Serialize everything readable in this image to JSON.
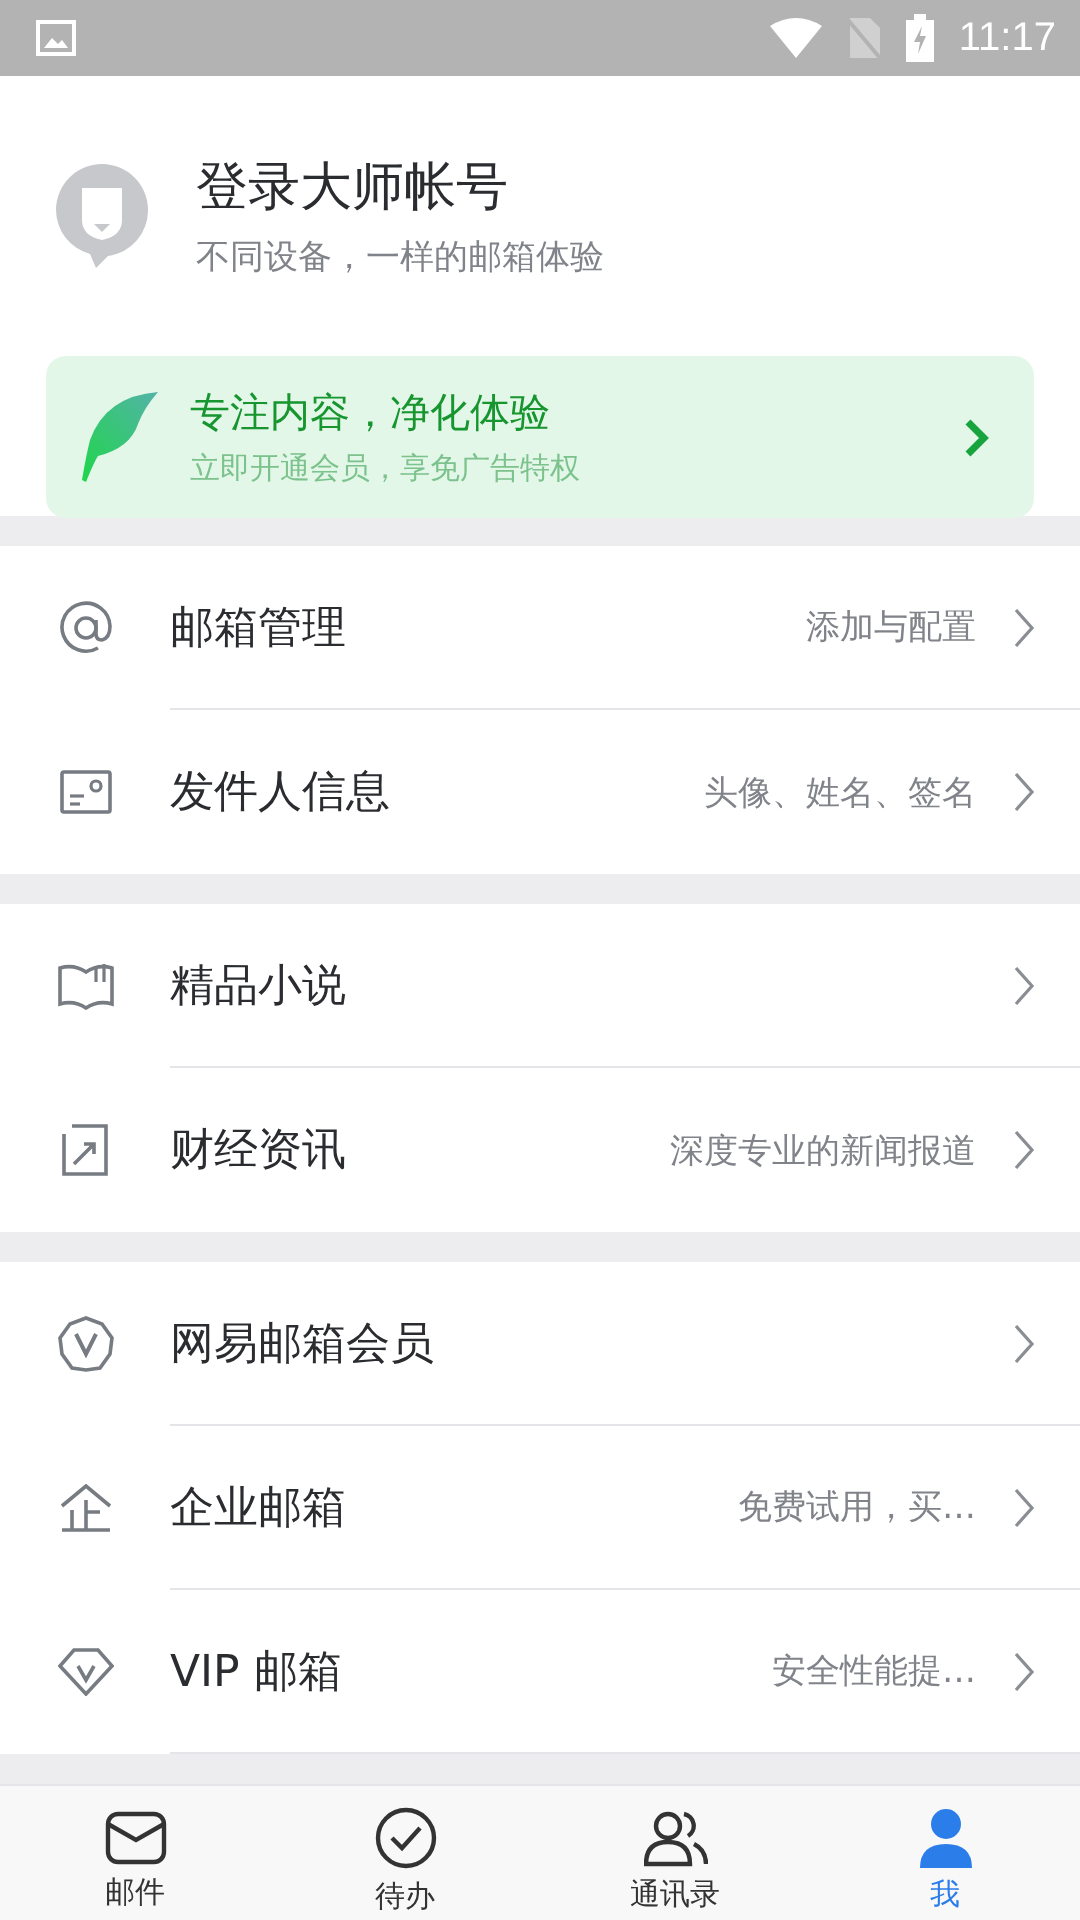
{
  "status_bar": {
    "time": "11:17"
  },
  "account": {
    "title": "登录大师帐号",
    "subtitle": "不同设备，一样的邮箱体验"
  },
  "promo": {
    "title": "专注内容，净化体验",
    "subtitle": "立即开通会员，享免广告特权"
  },
  "menu_groups": [
    {
      "items": [
        {
          "kind": "at",
          "label": "邮箱管理",
          "detail": "添加与配置"
        },
        {
          "kind": "card",
          "label": "发件人信息",
          "detail": "头像、姓名、签名"
        }
      ]
    },
    {
      "items": [
        {
          "kind": "book",
          "label": "精品小说"
        },
        {
          "kind": "chart",
          "label": "财经资讯",
          "detail": "深度专业的新闻报道"
        }
      ]
    },
    {
      "items": [
        {
          "kind": "badge",
          "label": "网易邮箱会员"
        },
        {
          "kind": "enterprise",
          "label": "企业邮箱",
          "detail": "免费试用，买…"
        },
        {
          "kind": "diamond",
          "label": "VIP 邮箱",
          "detail": "安全性能提…"
        }
      ]
    }
  ],
  "tab_bar": [
    {
      "kind": "mail",
      "label": "邮件",
      "selected": false
    },
    {
      "kind": "todo",
      "label": "待办",
      "selected": false
    },
    {
      "kind": "contacts",
      "label": "通讯录",
      "selected": false
    },
    {
      "kind": "me",
      "label": "我",
      "selected": true
    }
  ]
}
